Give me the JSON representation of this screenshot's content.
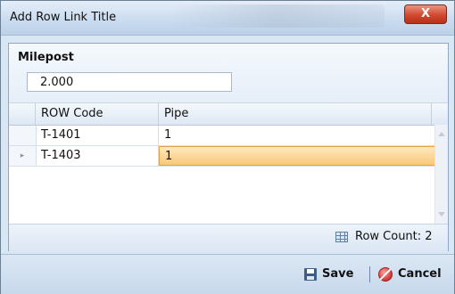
{
  "window": {
    "title": "Add Row Link Title",
    "close_glyph": "X"
  },
  "milepost": {
    "label": "Milepost",
    "value": "2.000"
  },
  "grid": {
    "columns": [
      "ROW Code",
      "Pipe"
    ],
    "rows": [
      {
        "row_code": "T-1401",
        "pipe": "1",
        "selected": false
      },
      {
        "row_code": "T-1403",
        "pipe": "1",
        "selected": true
      }
    ],
    "current_row_indicator": "▸"
  },
  "status": {
    "row_count_label": "Row Count: 2"
  },
  "footer": {
    "save_label": "Save",
    "cancel_label": "Cancel"
  },
  "icons": {
    "close": "close-icon",
    "row_count": "grid-table-icon",
    "save": "floppy-disk-icon",
    "cancel": "cancel-circle-icon"
  },
  "colors": {
    "selection": "#f9c879",
    "close_button": "#d1492f",
    "chrome": "#c9dbef"
  }
}
